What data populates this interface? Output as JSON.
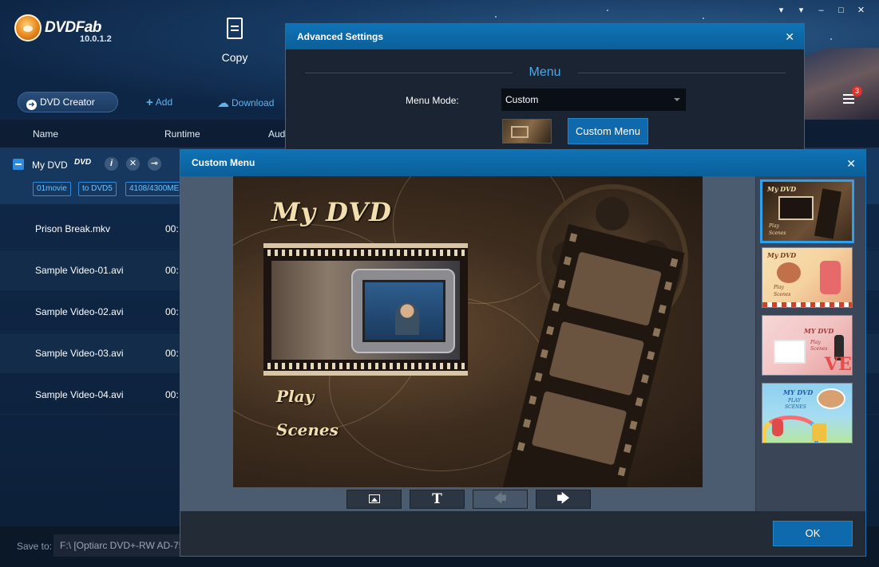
{
  "app": {
    "name": "DVDFab",
    "version": "10.0.1.2",
    "window_controls": [
      "▾",
      "▾",
      "–",
      "□",
      "✕"
    ]
  },
  "module": {
    "label": "Copy",
    "icon": "document-icon"
  },
  "toolbar": {
    "creator_label": "DVD Creator",
    "add_label": "Add",
    "download_label": "Download",
    "tasks_badge": "3"
  },
  "list": {
    "columns": [
      "Name",
      "Runtime",
      "Aud"
    ],
    "group": {
      "name": "My DVD",
      "disc_logo": "DVD",
      "tags": [
        "01movie",
        "to DVD5",
        "4108/4300ME"
      ]
    },
    "files": [
      {
        "name": "Prison Break.mkv",
        "runtime": "00:"
      },
      {
        "name": "Sample Video-01.avi",
        "runtime": "00:"
      },
      {
        "name": "Sample Video-02.avi",
        "runtime": "00:"
      },
      {
        "name": "Sample Video-03.avi",
        "runtime": "00:"
      },
      {
        "name": "Sample Video-04.avi",
        "runtime": "00:"
      }
    ]
  },
  "footer": {
    "save_to_label": "Save to:",
    "save_path": "F:\\ [Optiarc DVD+-RW AD-75"
  },
  "advanced_settings": {
    "title": "Advanced Settings",
    "section": "Menu",
    "menu_mode_label": "Menu Mode:",
    "menu_mode_value": "Custom",
    "custom_menu_button": "Custom Menu"
  },
  "custom_menu": {
    "title": "Custom Menu",
    "preview": {
      "title": "My DVD",
      "items": [
        "Play",
        "Scenes"
      ]
    },
    "tools": [
      {
        "name": "background-image-tool",
        "icon": "image-icon"
      },
      {
        "name": "text-tool",
        "icon": "text-icon",
        "glyph": "T"
      },
      {
        "name": "previous-tool",
        "icon": "arrow-left-icon",
        "glyph": "🡄"
      },
      {
        "name": "next-tool",
        "icon": "arrow-right-icon",
        "glyph": "🡆"
      }
    ],
    "templates": [
      {
        "title": "My DVD",
        "items": [
          "Play",
          "Scenes"
        ],
        "colors": [
          "#3b2a1c",
          "#6d5035"
        ],
        "text_color": "#f3dfae"
      },
      {
        "title": "My DVD",
        "items": [
          "Play",
          "Scenes"
        ],
        "colors": [
          "#f5d3a0",
          "#e7a07a"
        ],
        "text_color": "#7a3d1a"
      },
      {
        "title": "MY DVD",
        "items": [
          "Play",
          "Scenes"
        ],
        "colors": [
          "#f2c4c4",
          "#e79a9a"
        ],
        "text_color": "#a33b3b"
      },
      {
        "title": "MY DVD",
        "items": [
          "PLAY",
          "SCENES"
        ],
        "colors": [
          "#8ed0f0",
          "#b6e6a0"
        ],
        "text_color": "#1f5ea8"
      }
    ],
    "ok_label": "OK"
  },
  "colors": {
    "accent": "#0e6aad",
    "link": "#5fb2ee",
    "title_bar": "#0f73b6",
    "menu_text": "#f3dfae",
    "selection": "#2ea0f0"
  }
}
